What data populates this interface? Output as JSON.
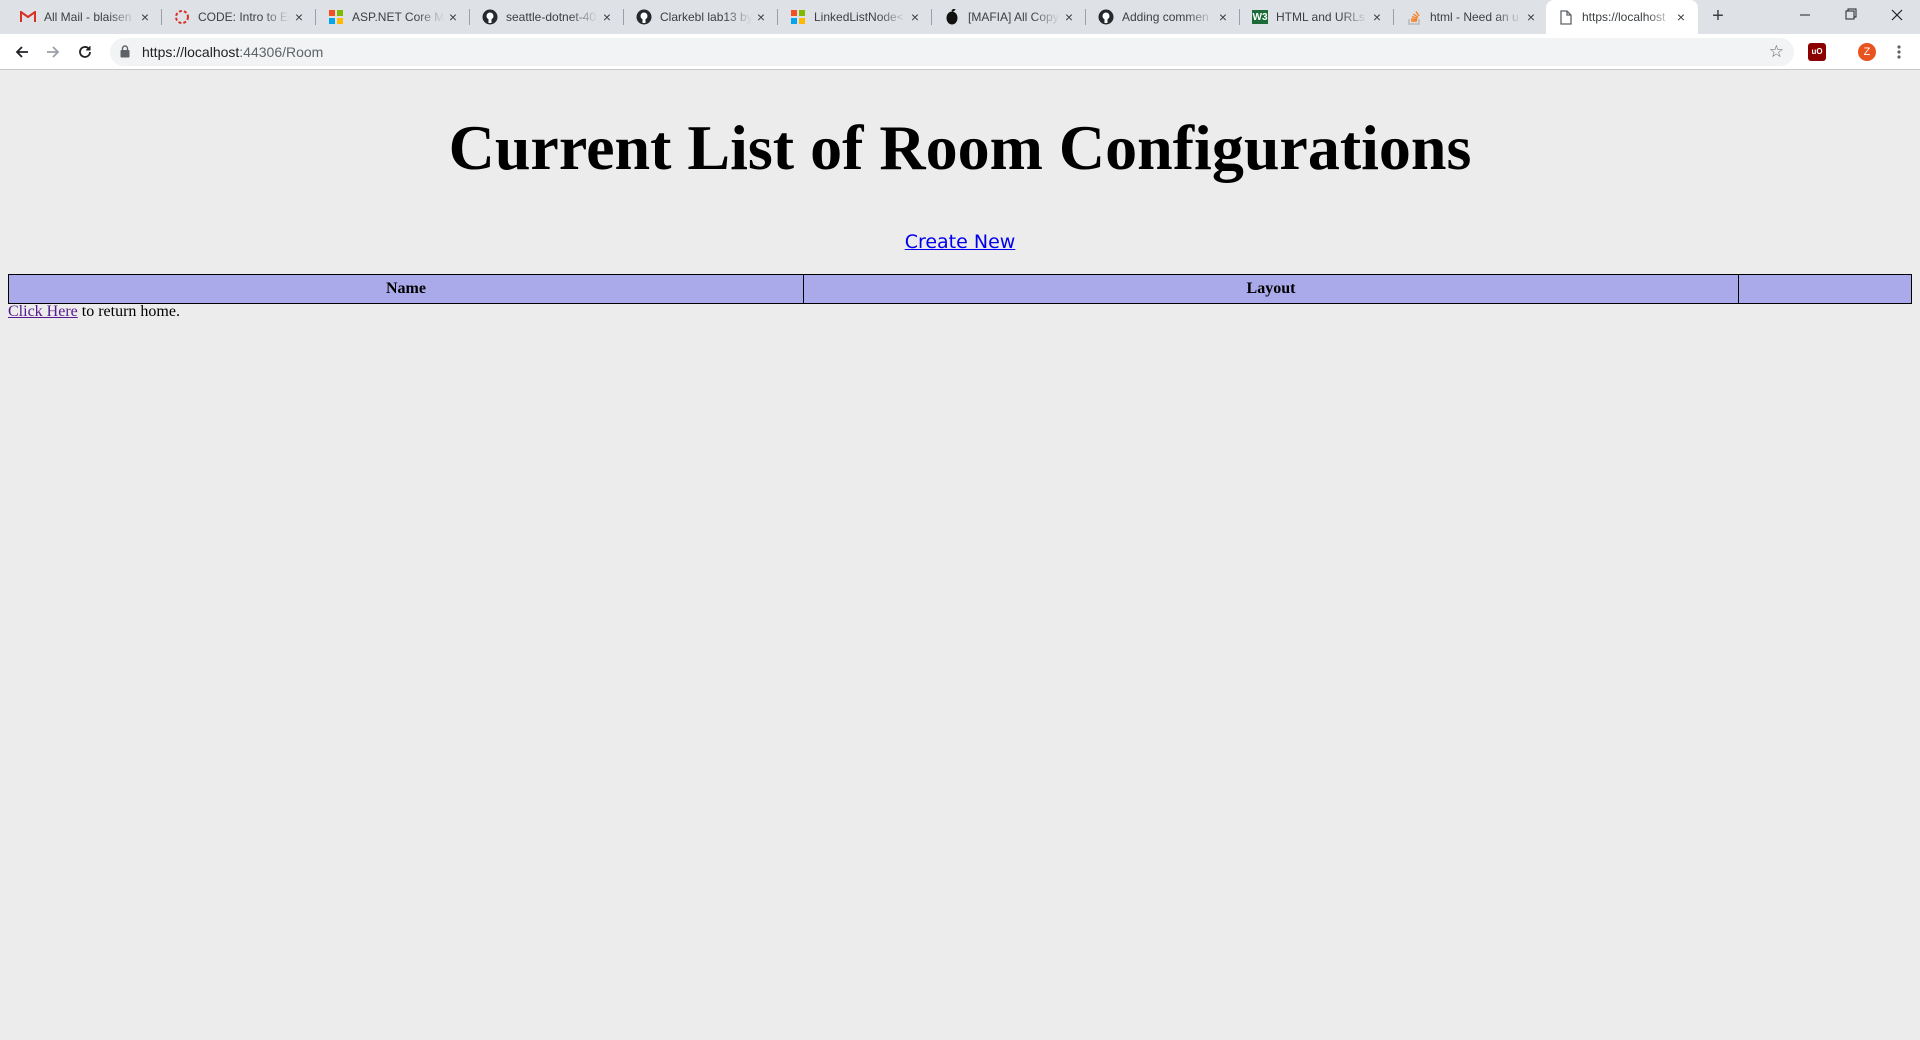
{
  "browser": {
    "tabs": [
      {
        "title": "All Mail - blaisen",
        "icon": "gmail-icon",
        "active": false
      },
      {
        "title": "CODE: Intro to En",
        "icon": "code-fellows-icon",
        "active": false
      },
      {
        "title": "ASP.NET Core MVC",
        "icon": "microsoft-icon",
        "active": false
      },
      {
        "title": "seattle-dotnet-40",
        "icon": "github-icon",
        "active": false
      },
      {
        "title": "Clarkebl lab13 by",
        "icon": "github-icon",
        "active": false
      },
      {
        "title": "LinkedListNode<",
        "icon": "microsoft-icon",
        "active": false
      },
      {
        "title": "[MAFIA] All Copy",
        "icon": "mafia-icon",
        "active": false
      },
      {
        "title": "Adding commen",
        "icon": "github-icon",
        "active": false
      },
      {
        "title": "HTML and URLs",
        "icon": "w3schools-icon",
        "active": false
      },
      {
        "title": "html - Need an u",
        "icon": "stackoverflow-icon",
        "active": false
      },
      {
        "title": "https://localhost",
        "icon": "page-icon",
        "active": true
      }
    ],
    "new_tab_symbol": "+",
    "address": {
      "host": "https://localhost",
      "path": ":44306/Room"
    },
    "profile_initial": "Z",
    "extension_label": "uO"
  },
  "page": {
    "heading": "Current List of Room Configurations",
    "create_link": "Create New",
    "table_headers": [
      "Name",
      "Layout",
      ""
    ],
    "home_link": "Click Here",
    "home_text": " to return home."
  },
  "colors": {
    "table_header_bg": "#aaaaea",
    "page_bg": "#ececec",
    "link": "#0000ee",
    "visited_link": "#551a8b"
  }
}
